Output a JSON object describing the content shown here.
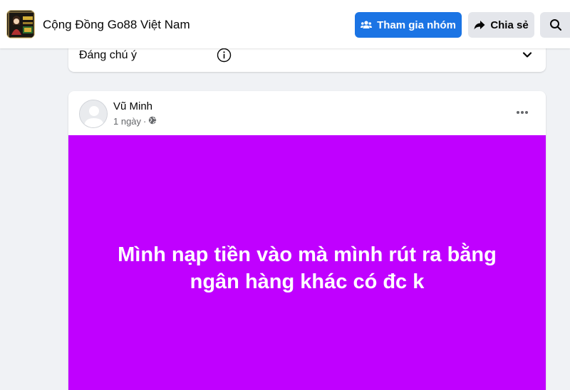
{
  "header": {
    "group_name": "Cộng Đồng Go88 Việt Nam",
    "group_avatar_icon": "group-cover-thumbnail",
    "join_button_label": "Tham gia nhóm",
    "join_icon": "people-icon",
    "share_button_label": "Chia sẻ",
    "share_icon": "share-arrow-icon",
    "search_icon": "search-icon"
  },
  "featured": {
    "label": "Đáng chú ý",
    "info_icon": "info-icon",
    "toggle_icon": "chevron-down-icon"
  },
  "post": {
    "author_name": "Vũ Minh",
    "time_ago": "1 ngày",
    "separator": "·",
    "privacy_icon": "globe-icon",
    "more_icon": "more-options-icon",
    "text": "Mình nạp tiền vào mà mình rút ra bằng ngân hàng khác có đc k",
    "background_color": "#c000ff"
  },
  "colors": {
    "primary": "#1b74e4",
    "page_background": "#f0f2f5"
  }
}
